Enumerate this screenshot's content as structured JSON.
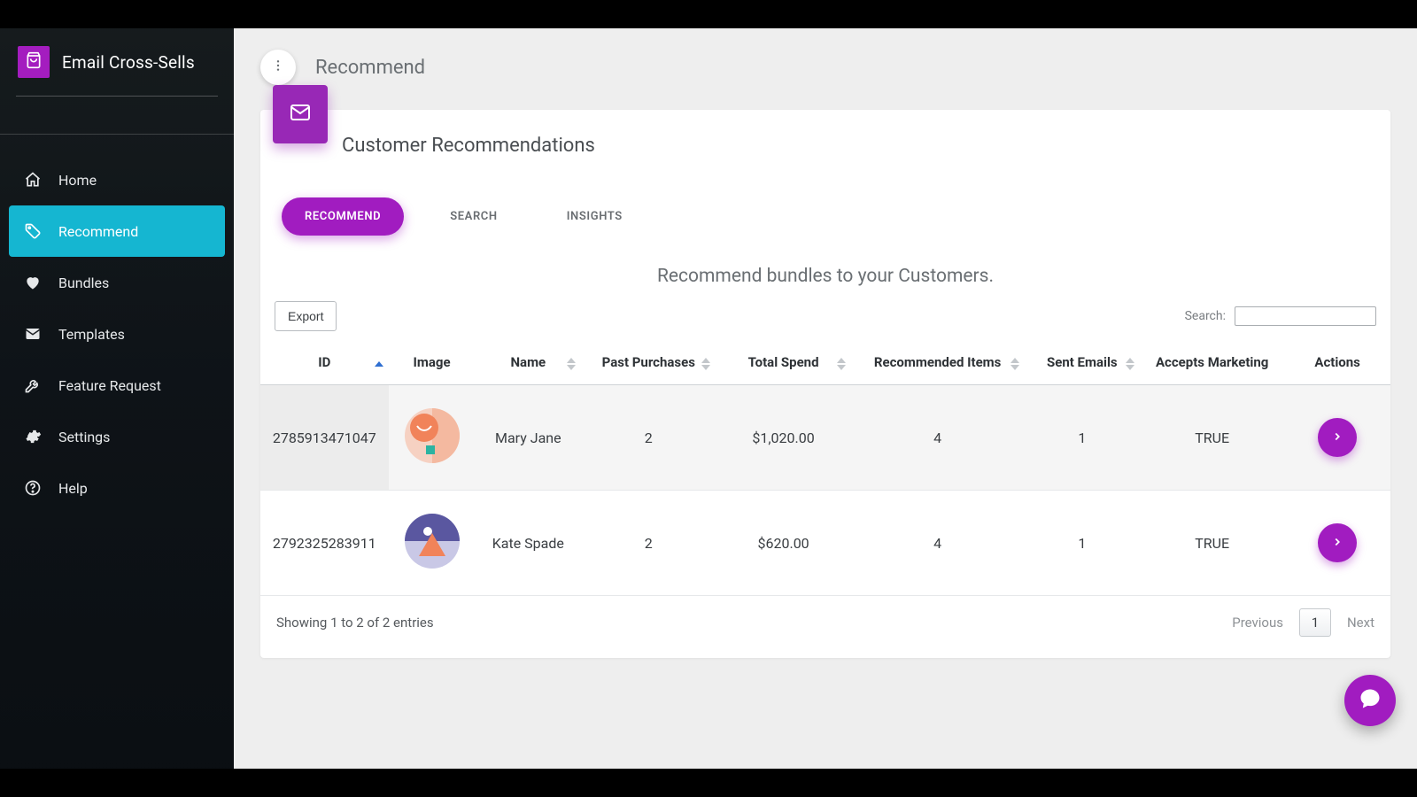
{
  "brand": {
    "title": "Email Cross-Sells"
  },
  "sidebar": {
    "items": [
      {
        "label": "Home"
      },
      {
        "label": "Recommend"
      },
      {
        "label": "Bundles"
      },
      {
        "label": "Templates"
      },
      {
        "label": "Feature Request"
      },
      {
        "label": "Settings"
      },
      {
        "label": "Help"
      }
    ]
  },
  "page": {
    "title": "Recommend"
  },
  "card": {
    "title": "Customer Recommendations",
    "tabs": [
      {
        "label": "RECOMMEND"
      },
      {
        "label": "SEARCH"
      },
      {
        "label": "INSIGHTS"
      }
    ],
    "subtitle": "Recommend bundles to your Customers.",
    "export_label": "Export",
    "search_label": "Search:",
    "columns": {
      "id": "ID",
      "image": "Image",
      "name": "Name",
      "past_purchases": "Past Purchases",
      "total_spend": "Total Spend",
      "recommended_items": "Recommended Items",
      "sent_emails": "Sent Emails",
      "accepts_marketing": "Accepts Marketing",
      "actions": "Actions"
    },
    "rows": [
      {
        "id": "2785913471047",
        "name": "Mary Jane",
        "past_purchases": "2",
        "total_spend": "$1,020.00",
        "recommended_items": "4",
        "sent_emails": "1",
        "accepts_marketing": "TRUE"
      },
      {
        "id": "2792325283911",
        "name": "Kate Spade",
        "past_purchases": "2",
        "total_spend": "$620.00",
        "recommended_items": "4",
        "sent_emails": "1",
        "accepts_marketing": "TRUE"
      }
    ],
    "pager": {
      "info": "Showing 1 to 2 of 2 entries",
      "previous": "Previous",
      "next": "Next",
      "page": "1"
    }
  }
}
